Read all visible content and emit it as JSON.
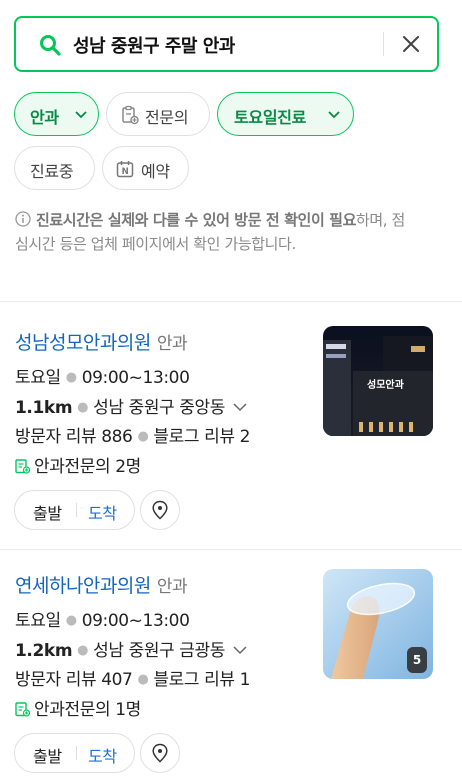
{
  "search": {
    "query": "성남 중원구 주말 안과"
  },
  "filters": [
    {
      "label": "안과",
      "active": true,
      "icon": "chevron-down-icon"
    },
    {
      "label": "전문의",
      "active": false,
      "icon": "doctor-doc-icon"
    },
    {
      "label": "토요일진료",
      "active": true,
      "icon": "chevron-down-icon"
    },
    {
      "label": "진료중",
      "active": false
    },
    {
      "label": "예약",
      "active": false,
      "icon": "naver-booking-icon"
    }
  ],
  "notice": {
    "bold": "진료시간은 실제와 다를 수 있어 방문 전 확인이 필요",
    "rest": "하며, 점심시간 등은 업체 페이지에서 확인 가능합니다."
  },
  "results": [
    {
      "name": "성남성모안과의원",
      "category": "안과",
      "day": "토요일",
      "hours": "09:00~13:00",
      "distance": "1.1km",
      "address": "성남 중원구 중앙동",
      "visitor_reviews": "방문자 리뷰 886",
      "blog_reviews": "블로그 리뷰 2",
      "specialists": "안과전문의 2명",
      "photo_sign": "성모안과",
      "photo_count": ""
    },
    {
      "name": "연세하나안과의원",
      "category": "안과",
      "day": "토요일",
      "hours": "09:00~13:00",
      "distance": "1.2km",
      "address": "성남 중원구 금광동",
      "visitor_reviews": "방문자 리뷰 407",
      "blog_reviews": "블로그 리뷰 1",
      "specialists": "안과전문의 1명",
      "photo_sign": "",
      "photo_count": "5"
    }
  ],
  "actions": {
    "start": "출발",
    "arrive": "도착"
  },
  "colors": {
    "accent": "#03c75a",
    "link": "#1565c0",
    "arrive": "#1e6fd9"
  }
}
